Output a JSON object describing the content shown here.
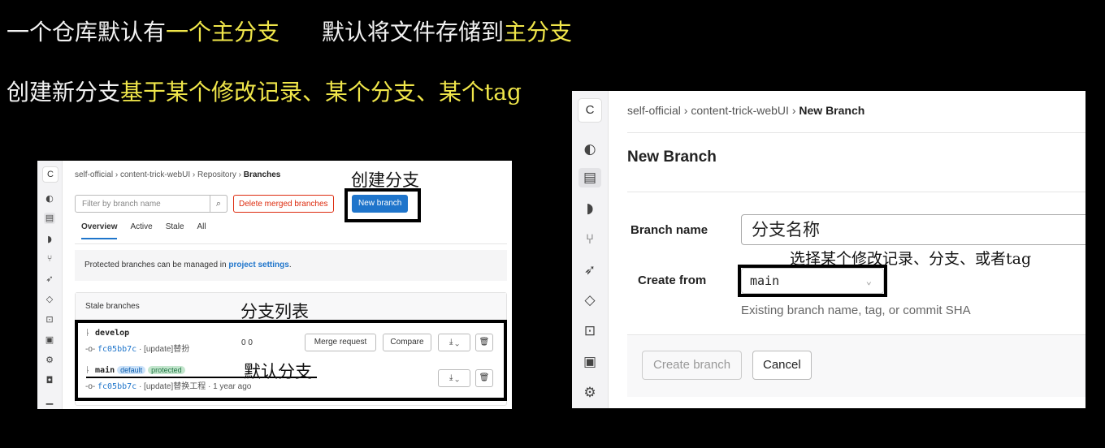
{
  "captions": {
    "line1": {
      "w1": "一个仓库默认有",
      "y1": "一个主分支",
      "w2": "默认将文件存储到",
      "y2": "主分支"
    },
    "line2": {
      "w1": "创建新分支",
      "y1": "基于某个修改记录、某个分支、某个tag"
    }
  },
  "branches_page": {
    "avatar": "C",
    "breadcrumb": [
      "self-official",
      "content-trick-webUI",
      "Repository",
      "Branches"
    ],
    "breadcrumb_sep": "›",
    "filter_placeholder": "Filter by branch name",
    "delete_merged_label": "Delete merged branches",
    "new_branch_label": "New branch",
    "tabs": [
      "Overview",
      "Active",
      "Stale",
      "All"
    ],
    "active_tab": "Overview",
    "protected_notice_prefix": "Protected branches can be managed in ",
    "protected_notice_link": "project settings",
    "protected_notice_suffix": ".",
    "stale_header": "Stale branches",
    "rows": [
      {
        "name": "develop",
        "sha": "fc05bb7c",
        "message": "· [update]替扮",
        "counts": "0 0",
        "merge_label": "Merge request",
        "compare_label": "Compare",
        "download": "⤓ ⌄",
        "delete": "🗑"
      },
      {
        "name": "main",
        "badges": [
          "default",
          "protected"
        ],
        "sha": "fc05bb7c",
        "message": "· [update]替换工程 · 1 year ago",
        "download": "⤓ ⌄",
        "delete": "🗑"
      }
    ]
  },
  "new_branch_page": {
    "avatar": "C",
    "breadcrumb": [
      "self-official",
      "content-trick-webUI",
      "New Branch"
    ],
    "breadcrumb_sep": "›",
    "title": "New Branch",
    "branch_name_label": "Branch name",
    "branch_name_value": "分支名称",
    "create_from_label": "Create from",
    "create_from_value": "main",
    "hint": "Existing branch name, tag, or commit SHA",
    "create_button": "Create branch",
    "cancel_button": "Cancel"
  },
  "annotations": {
    "create_branch": "创建分支",
    "branch_list": "分支列表",
    "default_branch": "默认分支",
    "select_source": "选择某个修改记录、分支、或者tag"
  },
  "icons": [
    "branch-icon",
    "commit-icon",
    "search-icon",
    "download-icon",
    "trash-icon",
    "chevron-down-icon"
  ]
}
